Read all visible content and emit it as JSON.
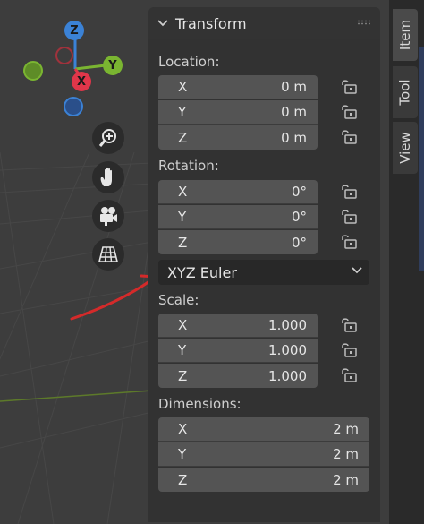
{
  "gizmo": {
    "z_label": "Z",
    "y_label": "Y",
    "x_label": "X",
    "colors": {
      "x": "#e0364a",
      "y": "#7ab531",
      "z": "#3b82d6"
    }
  },
  "nav": {
    "icons": [
      "zoom-icon",
      "hand-pan-icon",
      "camera-icon",
      "grid-perspective-icon"
    ]
  },
  "panel": {
    "title": "Transform",
    "location": {
      "label": "Location:",
      "rows": [
        {
          "axis": "X",
          "value": "0 m"
        },
        {
          "axis": "Y",
          "value": "0 m"
        },
        {
          "axis": "Z",
          "value": "0 m"
        }
      ]
    },
    "rotation": {
      "label": "Rotation:",
      "rows": [
        {
          "axis": "X",
          "value": "0°"
        },
        {
          "axis": "Y",
          "value": "0°"
        },
        {
          "axis": "Z",
          "value": "0°"
        }
      ],
      "mode": "XYZ Euler"
    },
    "scale": {
      "label": "Scale:",
      "rows": [
        {
          "axis": "X",
          "value": "1.000"
        },
        {
          "axis": "Y",
          "value": "1.000"
        },
        {
          "axis": "Z",
          "value": "1.000"
        }
      ]
    },
    "dimensions": {
      "label": "Dimensions:",
      "rows": [
        {
          "axis": "X",
          "value": "2 m"
        },
        {
          "axis": "Y",
          "value": "2 m"
        },
        {
          "axis": "Z",
          "value": "2 m"
        }
      ]
    }
  },
  "tabs": {
    "item": "Item",
    "tool": "Tool",
    "view": "View"
  },
  "annotation": {
    "color": "#d42a2a"
  }
}
